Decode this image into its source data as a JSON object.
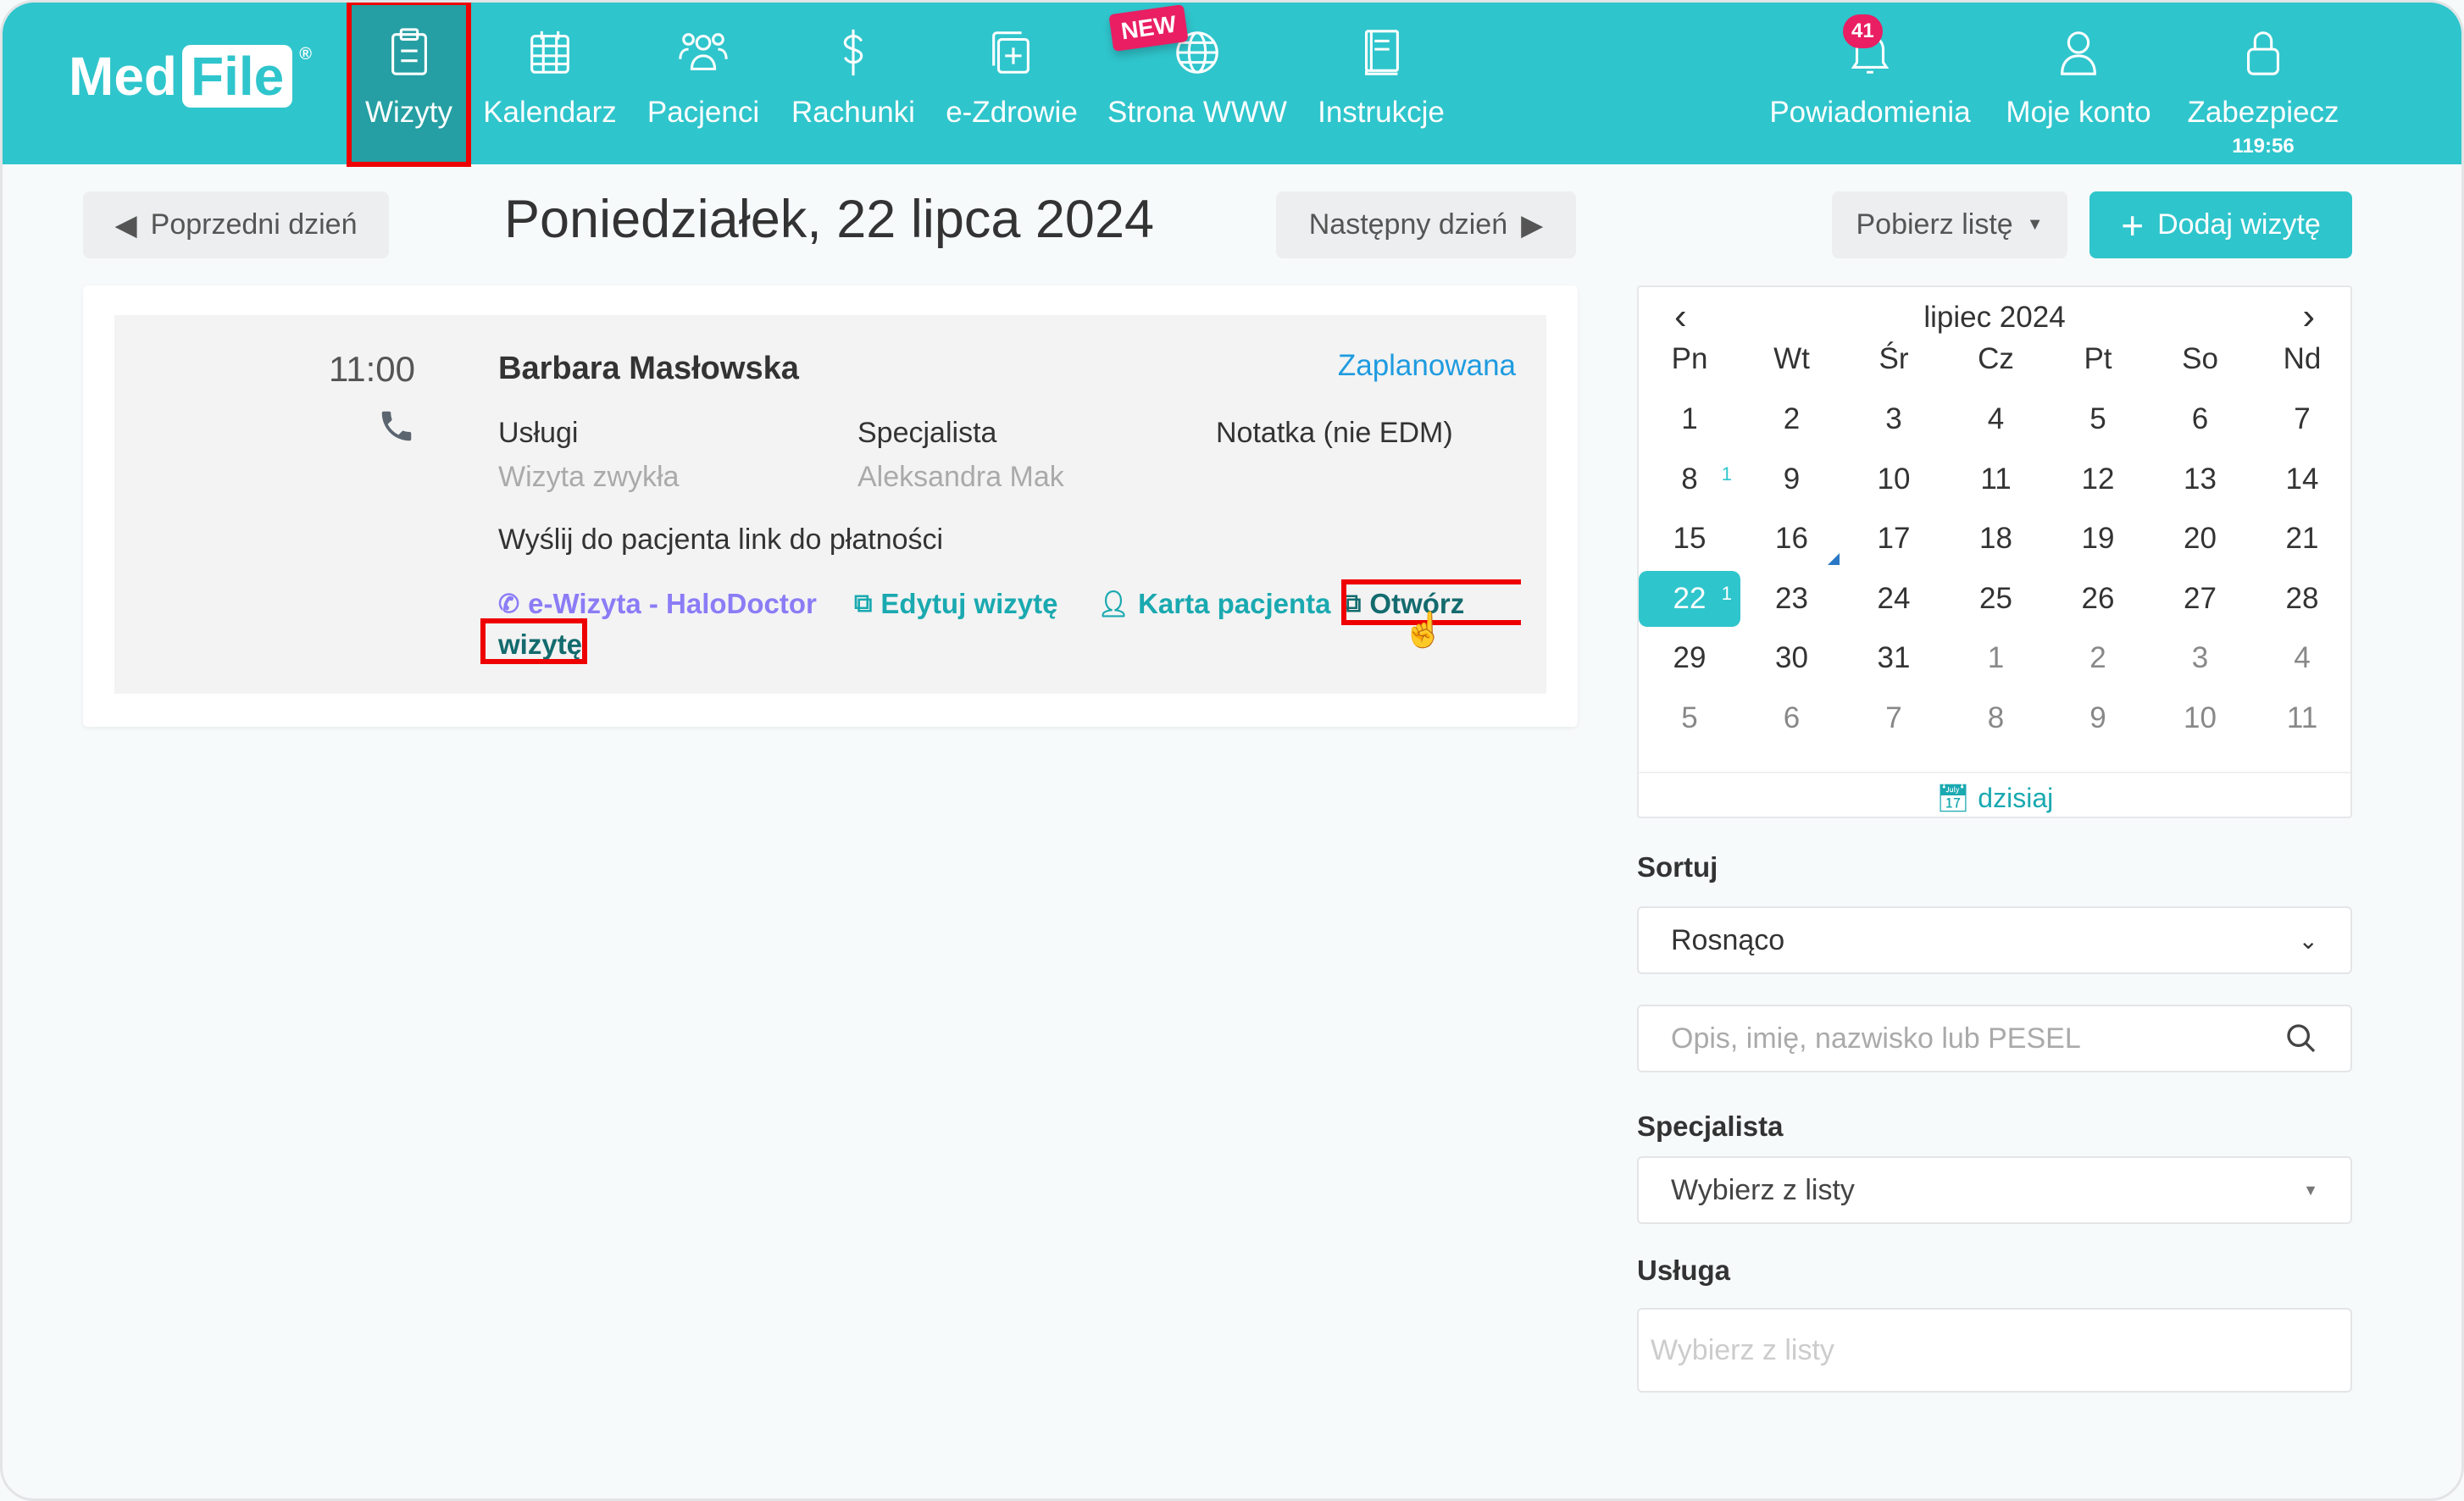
{
  "nav": {
    "logo": "MedFile",
    "logo_med": "Med",
    "logo_file": "File",
    "logo_reg": "®",
    "new_badge": "NEW",
    "items": [
      {
        "label": "Wizyty",
        "icon": "clipboard-icon",
        "active": true
      },
      {
        "label": "Kalendarz",
        "icon": "calendar-icon"
      },
      {
        "label": "Pacjenci",
        "icon": "users-icon"
      },
      {
        "label": "Rachunki",
        "icon": "dollar-icon"
      },
      {
        "label": "e-Zdrowie",
        "icon": "medical-file-icon"
      },
      {
        "label": "Strona WWW",
        "icon": "globe-icon"
      },
      {
        "label": "Instrukcje",
        "icon": "book-icon"
      }
    ],
    "right": [
      {
        "label": "Powiadomienia",
        "icon": "bell-icon",
        "badge": "41"
      },
      {
        "label": "Moje konto",
        "icon": "user-icon"
      },
      {
        "label": "Zabezpiecz",
        "icon": "lock-icon",
        "sub": "119:56"
      }
    ]
  },
  "toolbar": {
    "prev": "Poprzedni dzień",
    "title": "Poniedziałek, 22 lipca 2024",
    "next": "Następny dzień",
    "download": "Pobierz listę",
    "add": "Dodaj wizytę"
  },
  "visit": {
    "time": "11:00",
    "patient": "Barbara Masłowska",
    "status": "Zaplanowana",
    "services_label": "Usługi",
    "services": "Wizyta zwykła",
    "specialist_label": "Specjalista",
    "specialist": "Aleksandra Mak",
    "note_label": "Notatka (nie EDM)",
    "payment_link": "Wyślij do pacjenta link do płatności",
    "actions": {
      "ewizyta": "e-Wizyta - HaloDoctor",
      "edit": "Edytuj wizytę",
      "card": "Karta pacjenta",
      "open1": "Otwórz",
      "open2": "wizytę"
    }
  },
  "calendar": {
    "month": "lipiec 2024",
    "weekdays": [
      "Pn",
      "Wt",
      "Śr",
      "Cz",
      "Pt",
      "So",
      "Nd"
    ],
    "weeks": [
      [
        "1",
        "2",
        "3",
        "4",
        "5",
        "6",
        "7"
      ],
      [
        "8",
        "9",
        "10",
        "11",
        "12",
        "13",
        "14"
      ],
      [
        "15",
        "16",
        "17",
        "18",
        "19",
        "20",
        "21"
      ],
      [
        "22",
        "23",
        "24",
        "25",
        "26",
        "27",
        "28"
      ],
      [
        "29",
        "30",
        "31",
        "1",
        "2",
        "3",
        "4"
      ],
      [
        "5",
        "6",
        "7",
        "8",
        "9",
        "10",
        "11"
      ]
    ],
    "selected": "22",
    "counts": {
      "8": "1",
      "22": "1"
    },
    "today": "dzisiaj"
  },
  "filters": {
    "sort_label": "Sortuj",
    "sort_value": "Rosnąco",
    "search_placeholder": "Opis, imię, nazwisko lub PESEL",
    "specialist_label": "Specjalista",
    "specialist_value": "Wybierz z listy",
    "service_label": "Usługa",
    "service_placeholder": "Wybierz z listy"
  },
  "colors": {
    "accent": "#2fc5cc",
    "active": "#259fa3",
    "badge": "#e91e63",
    "link": "#1aa9b0",
    "purple": "#8b7cf6",
    "status": "#1e9be0"
  }
}
